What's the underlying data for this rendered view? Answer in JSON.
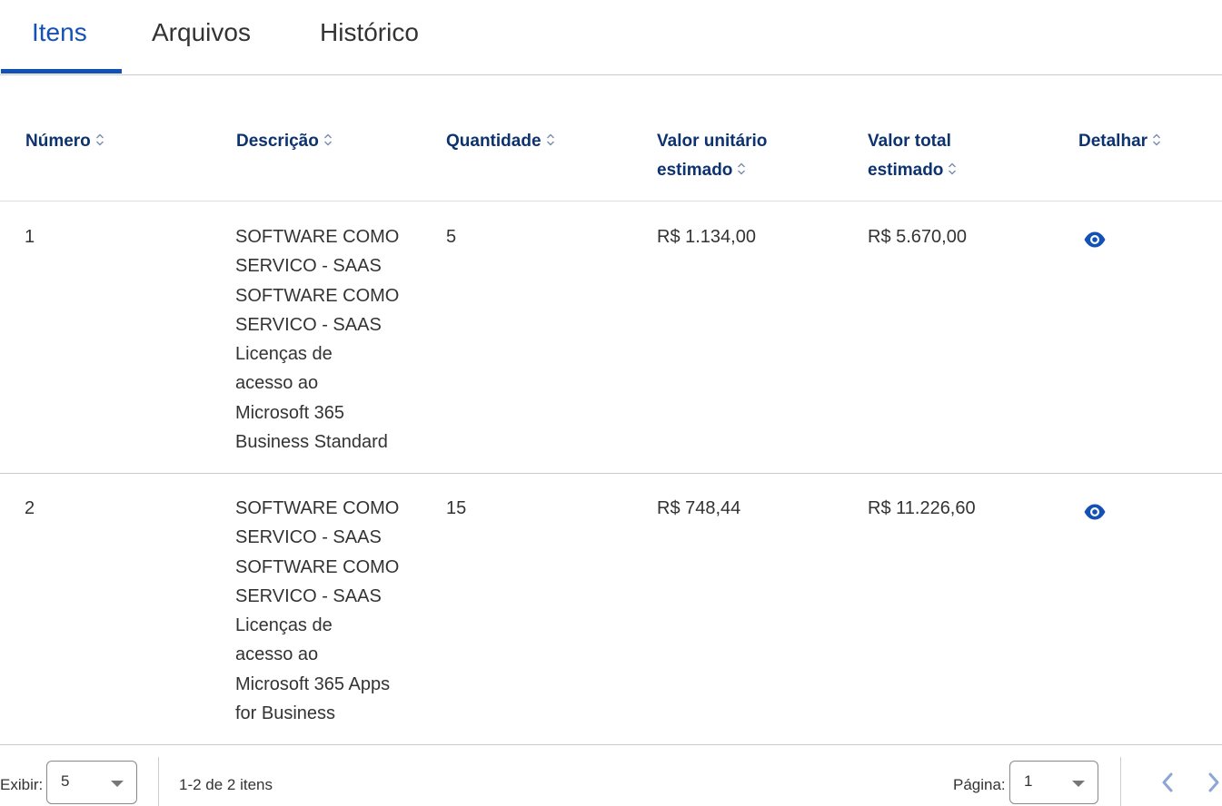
{
  "tabs": [
    {
      "label": "Itens",
      "active": true
    },
    {
      "label": "Arquivos",
      "active": false
    },
    {
      "label": "Histórico",
      "active": false
    }
  ],
  "table": {
    "headers": {
      "numero": "Número",
      "descricao": "Descrição",
      "quantidade": "Quantidade",
      "valor_unitario_1": "Valor unitário",
      "valor_unitario_2": "estimado",
      "valor_total_1": "Valor total",
      "valor_total_2": "estimado",
      "detalhar": "Detalhar"
    },
    "rows": [
      {
        "numero": "1",
        "descricao": [
          "SOFTWARE COMO",
          "SERVICO - SAAS",
          "SOFTWARE COMO",
          "SERVICO - SAAS",
          "Licenças de",
          "acesso ao",
          "Microsoft 365",
          "Business Standard"
        ],
        "quantidade": "5",
        "valor_unitario": "R$ 1.134,00",
        "valor_total": "R$ 5.670,00"
      },
      {
        "numero": "2",
        "descricao": [
          "SOFTWARE COMO",
          "SERVICO - SAAS",
          "SOFTWARE COMO",
          "SERVICO - SAAS",
          "Licenças de",
          "acesso ao",
          "Microsoft 365 Apps",
          "for Business"
        ],
        "quantidade": "15",
        "valor_unitario": "R$ 748,44",
        "valor_total": "R$ 11.226,60"
      }
    ]
  },
  "pagination": {
    "exibir_label": "Exibir:",
    "exibir_value": "5",
    "range_text": "1-2 de 2 itens",
    "pagina_label": "Página:",
    "pagina_value": "1"
  },
  "colors": {
    "primary": "#1351b4",
    "header_text": "#0c326f",
    "body_text": "#333333"
  },
  "icons": {
    "sort": "sort-updown-icon",
    "detail": "eye-icon",
    "prev": "chevron-left-icon",
    "next": "chevron-right-icon",
    "dropdown": "caret-down-icon"
  }
}
